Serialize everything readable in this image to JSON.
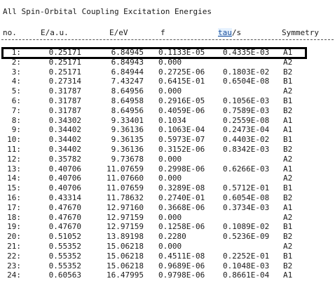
{
  "title": "All Spin-Orbital Coupling Excitation Energies",
  "headers": {
    "no": "no.",
    "au": "E/a.u.",
    "ev": "E/eV",
    "f": "f",
    "tau": "tau",
    "tau_unit": "/s",
    "sym": "Symmetry"
  },
  "rows": [
    {
      "no": "1:",
      "au": "0.25171",
      "ev": "6.84945",
      "f": "0.1133E-05",
      "tau": "0.4335E-03",
      "sym": "A1"
    },
    {
      "no": "2:",
      "au": "0.25171",
      "ev": "6.84943",
      "f": "0.000",
      "tau": "",
      "sym": "A2"
    },
    {
      "no": "3:",
      "au": "0.25171",
      "ev": "6.84944",
      "f": "0.2725E-06",
      "tau": "0.1803E-02",
      "sym": "B2"
    },
    {
      "no": "4:",
      "au": "0.27314",
      "ev": "7.43247",
      "f": "0.6415E-01",
      "tau": "0.6504E-08",
      "sym": "B1"
    },
    {
      "no": "5:",
      "au": "0.31787",
      "ev": "8.64956",
      "f": "0.000",
      "tau": "",
      "sym": "A2"
    },
    {
      "no": "6:",
      "au": "0.31787",
      "ev": "8.64958",
      "f": "0.2916E-05",
      "tau": "0.1056E-03",
      "sym": "B1"
    },
    {
      "no": "7:",
      "au": "0.31787",
      "ev": "8.64956",
      "f": "0.4059E-06",
      "tau": "0.7589E-03",
      "sym": "B2"
    },
    {
      "no": "8:",
      "au": "0.34302",
      "ev": "9.33401",
      "f": "0.1034",
      "tau": "0.2559E-08",
      "sym": "A1"
    },
    {
      "no": "9:",
      "au": "0.34402",
      "ev": "9.36136",
      "f": "0.1063E-04",
      "tau": "0.2473E-04",
      "sym": "A1"
    },
    {
      "no": "10:",
      "au": "0.34402",
      "ev": "9.36135",
      "f": "0.5973E-07",
      "tau": "0.4403E-02",
      "sym": "B1"
    },
    {
      "no": "11:",
      "au": "0.34402",
      "ev": "9.36136",
      "f": "0.3152E-06",
      "tau": "0.8342E-03",
      "sym": "B2"
    },
    {
      "no": "12:",
      "au": "0.35782",
      "ev": "9.73678",
      "f": "0.000",
      "tau": "",
      "sym": "A2"
    },
    {
      "no": "13:",
      "au": "0.40706",
      "ev": "11.07659",
      "f": "0.2998E-06",
      "tau": "0.6266E-03",
      "sym": "A1"
    },
    {
      "no": "14:",
      "au": "0.40706",
      "ev": "11.07660",
      "f": "0.000",
      "tau": "",
      "sym": "A2"
    },
    {
      "no": "15:",
      "au": "0.40706",
      "ev": "11.07659",
      "f": "0.3289E-08",
      "tau": "0.5712E-01",
      "sym": "B1"
    },
    {
      "no": "16:",
      "au": "0.43314",
      "ev": "11.78632",
      "f": "0.2740E-01",
      "tau": "0.6054E-08",
      "sym": "B2"
    },
    {
      "no": "17:",
      "au": "0.47670",
      "ev": "12.97160",
      "f": "0.3668E-06",
      "tau": "0.3734E-03",
      "sym": "A1"
    },
    {
      "no": "18:",
      "au": "0.47670",
      "ev": "12.97159",
      "f": "0.000",
      "tau": "",
      "sym": "A2"
    },
    {
      "no": "19:",
      "au": "0.47670",
      "ev": "12.97159",
      "f": "0.1258E-06",
      "tau": "0.1089E-02",
      "sym": "B1"
    },
    {
      "no": "20:",
      "au": "0.51052",
      "ev": "13.89198",
      "f": "0.2280",
      "tau": "0.5236E-09",
      "sym": "B2"
    },
    {
      "no": "21:",
      "au": "0.55352",
      "ev": "15.06218",
      "f": "0.000",
      "tau": "",
      "sym": "A2"
    },
    {
      "no": "22:",
      "au": "0.55352",
      "ev": "15.06218",
      "f": "0.4511E-08",
      "tau": "0.2252E-01",
      "sym": "B1"
    },
    {
      "no": "23:",
      "au": "0.55352",
      "ev": "15.06218",
      "f": "0.9689E-06",
      "tau": "0.1048E-03",
      "sym": "B2"
    },
    {
      "no": "24:",
      "au": "0.60563",
      "ev": "16.47995",
      "f": "0.9798E-06",
      "tau": "0.8661E-04",
      "sym": "A1"
    }
  ]
}
